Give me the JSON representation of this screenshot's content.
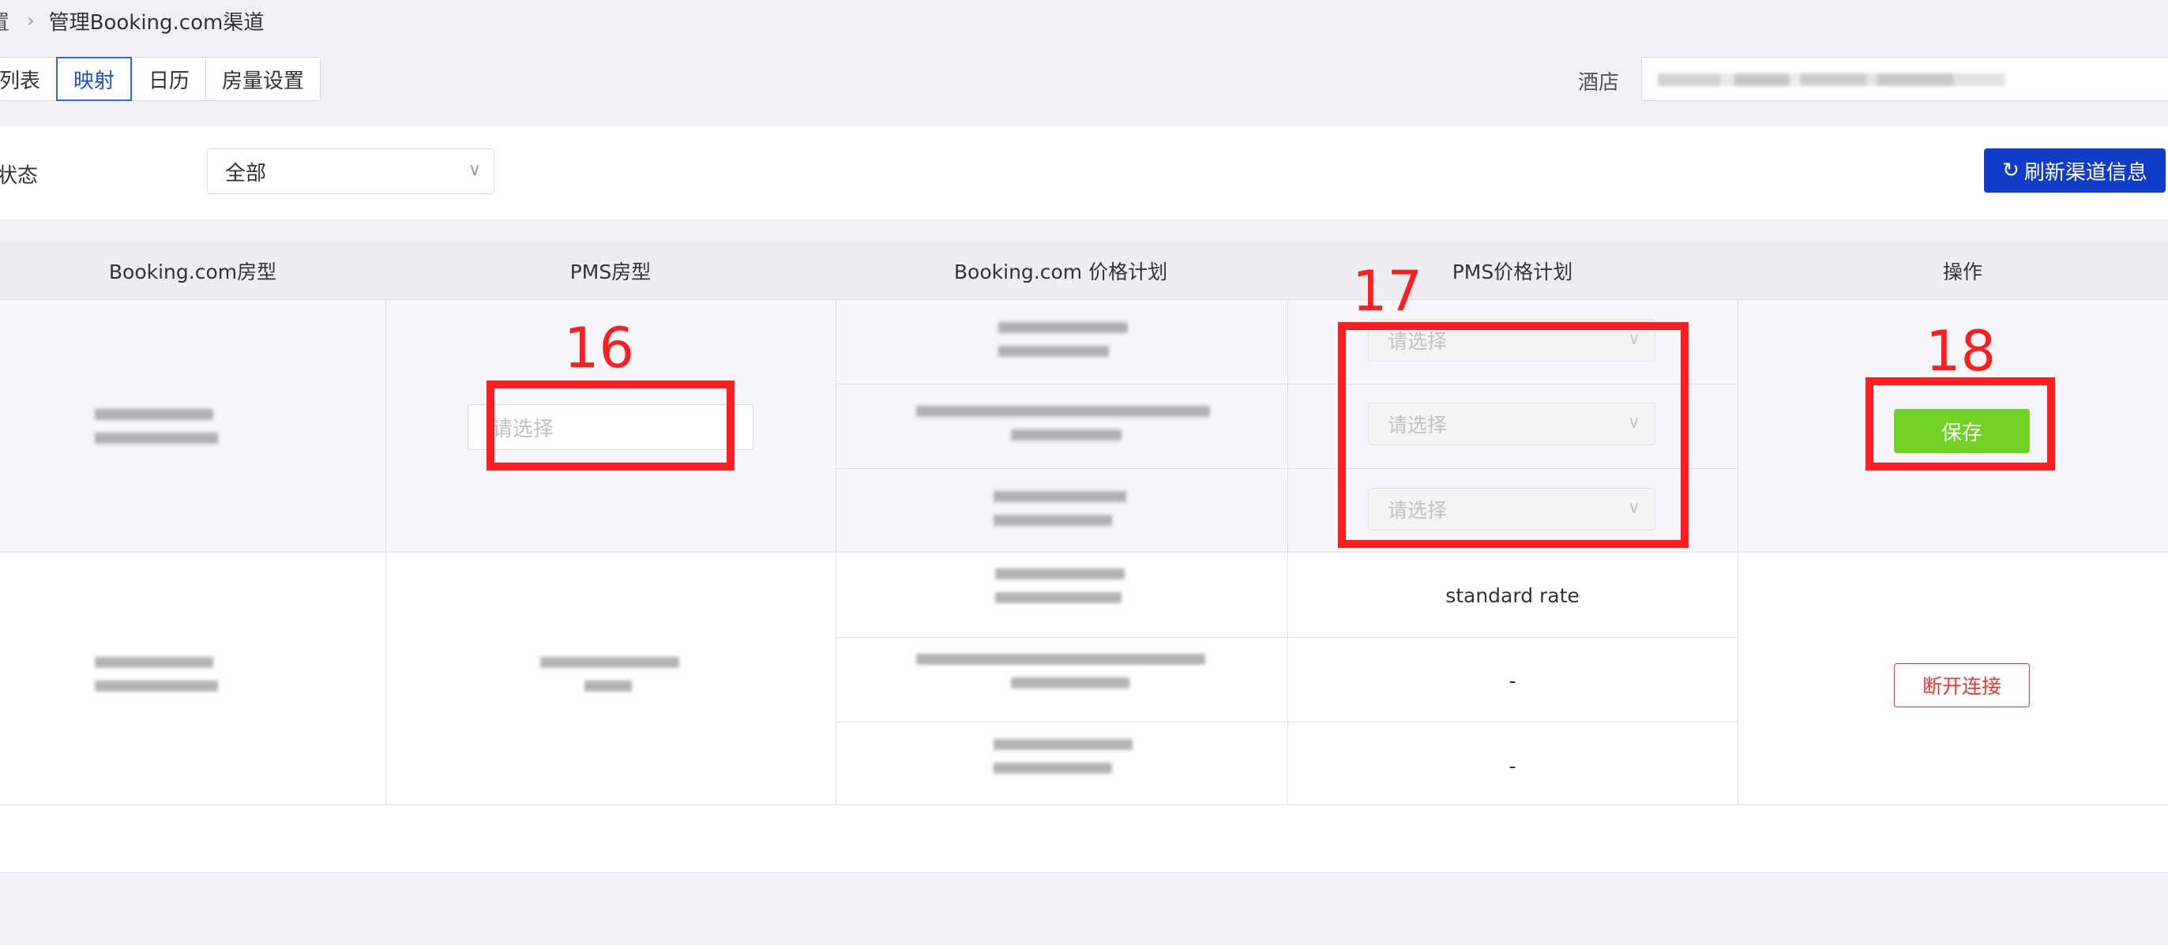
{
  "breadcrumb": {
    "prev": "置",
    "current": "管理Booking.com渠道"
  },
  "tabs": [
    {
      "label": "列表",
      "active": false
    },
    {
      "label": "映射",
      "active": true
    },
    {
      "label": "日历",
      "active": false
    },
    {
      "label": "房量设置",
      "active": false
    }
  ],
  "hotel": {
    "label": "酒店",
    "value": ""
  },
  "filter": {
    "status_label": "状态",
    "status_value": "全部"
  },
  "refresh_button": "刷新渠道信息",
  "table": {
    "headers": [
      "Booking.com房型",
      "PMS房型",
      "Booking.com 价格计划",
      "PMS价格计划",
      "操作"
    ],
    "row1": {
      "pms_room_placeholder": "请选择",
      "rate_plan_placeholders": [
        "请选择",
        "请选择",
        "请选择"
      ],
      "action": "保存"
    },
    "row2": {
      "pms_rate_plans": [
        "standard rate",
        "-",
        "-"
      ],
      "action": "断开连接"
    }
  },
  "annotations": [
    "16",
    "17",
    "18"
  ],
  "colors": {
    "primary": "#0f3dc7",
    "success": "#72d125",
    "danger": "#e53935",
    "annotation": "#ff1f1f"
  },
  "icons": [
    "chevron-right-icon",
    "chevron-down-icon",
    "refresh-icon"
  ]
}
